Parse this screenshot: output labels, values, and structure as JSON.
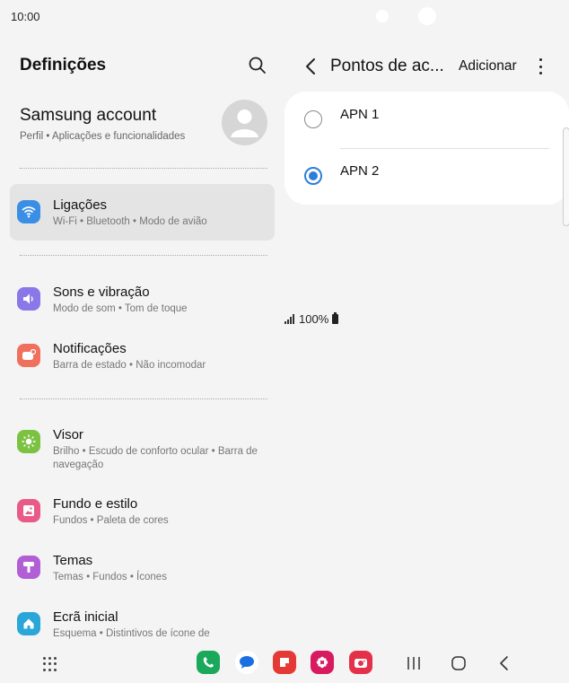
{
  "status": {
    "time": "10:00",
    "battery": "100%"
  },
  "left": {
    "title": "Definições",
    "account": {
      "name": "Samsung account",
      "sub": "Perfil  •  Aplicações e funcionalidades"
    },
    "items": [
      {
        "title": "Ligações",
        "sub": "Wi-Fi  •  Bluetooth  •  Modo de avião",
        "icon": "wifi-icon",
        "color": "#3a8ee6"
      },
      {
        "title": "Sons e vibração",
        "sub": "Modo de som  •  Tom de toque",
        "icon": "volume-icon",
        "color": "#8a78e8"
      },
      {
        "title": "Notificações",
        "sub": "Barra de estado  •  Não incomodar",
        "icon": "notification-icon",
        "color": "#f0705e"
      },
      {
        "title": "Visor",
        "sub": "Brilho  •  Escudo de conforto ocular  •  Barra de navegação",
        "icon": "brightness-icon",
        "color": "#7cc242"
      },
      {
        "title": "Fundo e estilo",
        "sub": "Fundos  •  Paleta de cores",
        "icon": "wallpaper-icon",
        "color": "#e95a88"
      },
      {
        "title": "Temas",
        "sub": "Temas  •  Fundos  •  Ícones",
        "icon": "themes-icon",
        "color": "#b25fd6"
      },
      {
        "title": "Ecrã inicial",
        "sub": "Esquema  •  Distintivos de ícone de",
        "icon": "home-icon",
        "color": "#2aa6d8"
      }
    ]
  },
  "right": {
    "title": "Pontos de ac...",
    "add_label": "Adicionar",
    "apns": [
      {
        "label": "APN 1",
        "selected": false
      },
      {
        "label": "APN 2",
        "selected": true
      }
    ]
  },
  "colors": {
    "accent": "#2d7ed8",
    "selected_bg": "#e4e4e4"
  }
}
